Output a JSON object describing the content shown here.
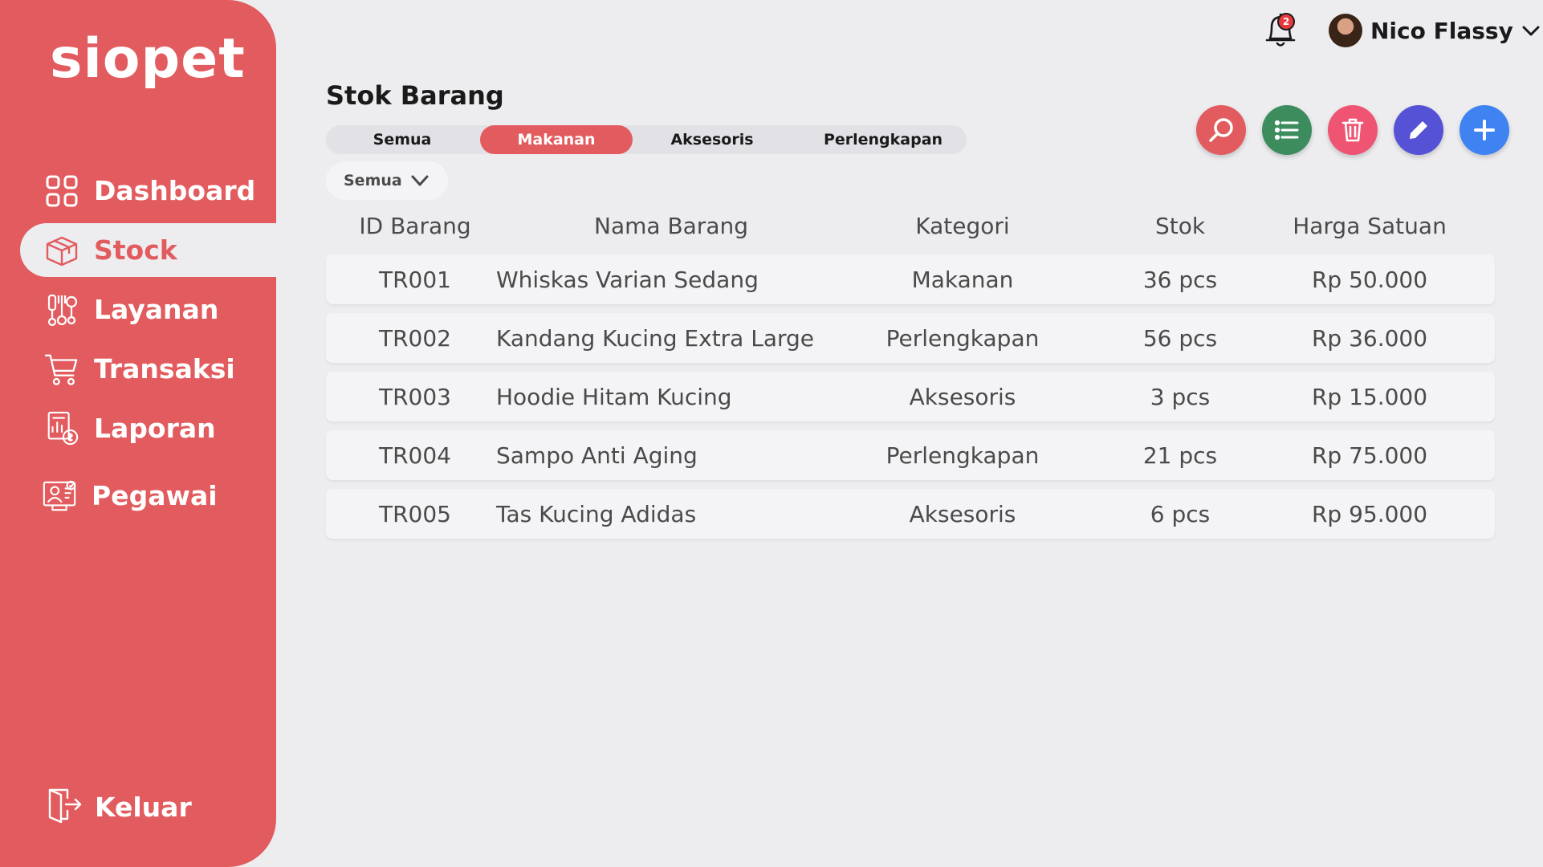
{
  "app": {
    "logo": "siopet"
  },
  "sidebar": {
    "items": [
      {
        "label": "Dashboard",
        "icon": "grid-icon",
        "active": false
      },
      {
        "label": "Stock",
        "icon": "box-icon",
        "active": true
      },
      {
        "label": "Layanan",
        "icon": "grooming-icon",
        "active": false
      },
      {
        "label": "Transaksi",
        "icon": "cart-icon",
        "active": false
      },
      {
        "label": "Laporan",
        "icon": "report-icon",
        "active": false
      },
      {
        "label": "Pegawai",
        "icon": "employee-icon",
        "active": false
      }
    ],
    "logout_label": "Keluar"
  },
  "header": {
    "notification_count": "2",
    "user_name": "Nico Flassy"
  },
  "main": {
    "title": "Stok Barang",
    "tabs": [
      {
        "label": "Semua",
        "active": false
      },
      {
        "label": "Makanan",
        "active": true
      },
      {
        "label": "Aksesoris",
        "active": false
      },
      {
        "label": "Perlengkapan",
        "active": false
      }
    ],
    "filter": {
      "selected": "Semua"
    },
    "actions": [
      {
        "name": "search",
        "color": "#e25c5f"
      },
      {
        "name": "list",
        "color": "#3d8c5e"
      },
      {
        "name": "delete",
        "color": "#ef5472"
      },
      {
        "name": "edit",
        "color": "#5552d6"
      },
      {
        "name": "add",
        "color": "#3f82f1"
      }
    ],
    "table": {
      "headers": [
        "ID Barang",
        "Nama Barang",
        "Kategori",
        "Stok",
        "Harga Satuan"
      ],
      "rows": [
        {
          "id": "TR001",
          "name": "Whiskas Varian Sedang",
          "category": "Makanan",
          "stock": "36 pcs",
          "price": "Rp 50.000"
        },
        {
          "id": "TR002",
          "name": "Kandang Kucing Extra Large",
          "category": "Perlengkapan",
          "stock": "56 pcs",
          "price": "Rp 36.000"
        },
        {
          "id": "TR003",
          "name": "Hoodie Hitam Kucing",
          "category": "Aksesoris",
          "stock": "3 pcs",
          "price": "Rp 15.000"
        },
        {
          "id": "TR004",
          "name": "Sampo Anti Aging",
          "category": "Perlengkapan",
          "stock": "21 pcs",
          "price": "Rp 75.000"
        },
        {
          "id": "TR005",
          "name": "Tas Kucing Adidas",
          "category": "Aksesoris",
          "stock": "6 pcs",
          "price": "Rp 95.000"
        }
      ]
    }
  },
  "colors": {
    "accent": "#e25c5f",
    "background": "#ededf0",
    "row": "#f4f4f6"
  }
}
